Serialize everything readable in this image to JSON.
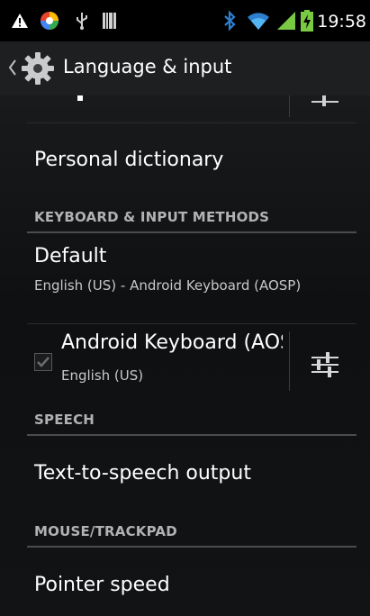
{
  "status_bar": {
    "time": "19:58",
    "icons": [
      "warning-icon",
      "app-notification-icon",
      "usb-icon",
      "barcode-icon",
      "bluetooth-icon",
      "wifi-icon",
      "signal-icon",
      "battery-charging-icon"
    ]
  },
  "action_bar": {
    "title": "Language & input",
    "icon": "settings-gear-icon"
  },
  "list": {
    "personal_dictionary": "Personal dictionary",
    "section_keyboard": "KEYBOARD & INPUT METHODS",
    "default_title": "Default",
    "default_subtitle": "English (US) - Android Keyboard (AOSP)",
    "keyboard_title": "Android Keyboard (AOSP)",
    "keyboard_subtitle": "English (US)",
    "keyboard_enabled": true,
    "section_speech": "SPEECH",
    "tts": "Text-to-speech output",
    "section_mouse": "MOUSE/TRACKPAD",
    "pointer_speed": "Pointer speed"
  },
  "colors": {
    "background": "#101214",
    "status_bar": "#000000",
    "accent_green": "#7ac943",
    "bluetooth": "#2f7fd0"
  }
}
